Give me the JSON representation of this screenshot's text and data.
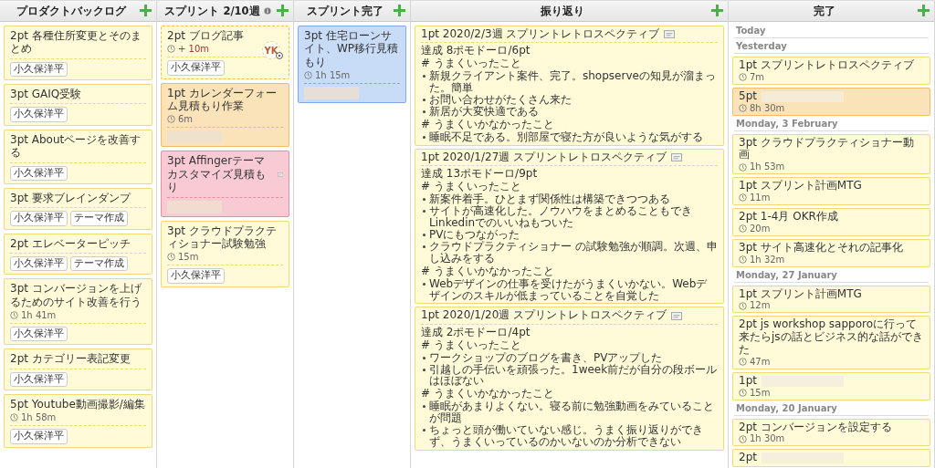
{
  "columns": [
    {
      "title": "プロダクトバックログ",
      "info": false,
      "cards": [
        {
          "title": "2pt 各種住所変更とそのまとめ",
          "color": "#fffbd9",
          "tags": [
            "小久保洋平"
          ]
        },
        {
          "title": "3pt GAIQ受験",
          "color": "#fffbd9",
          "tags": [
            "小久保洋平"
          ]
        },
        {
          "title": "3pt Aboutページを改善する",
          "color": "#fffbd9",
          "tags": [
            "小久保洋平"
          ]
        },
        {
          "title": "3pt 要求ブレインダンプ",
          "color": "#fffbd9",
          "tags": [
            "小久保洋平",
            "テーマ作成"
          ]
        },
        {
          "title": "2pt エレベーターピッチ",
          "color": "#fffbd9",
          "tags": [
            "小久保洋平",
            "テーマ作成"
          ]
        },
        {
          "title": "3pt コンバージョンを上げるためのサイト改善を行う",
          "color": "#fffbd9",
          "timer": {
            "text": "1h 41m",
            "overdue": false
          },
          "tags": [
            "小久保洋平"
          ]
        },
        {
          "title": "2pt カテゴリー表記変更",
          "color": "#fffbd9",
          "tags": [
            "小久保洋平"
          ]
        },
        {
          "title": "5pt Youtube動画撮影/編集",
          "color": "#fffbd9",
          "timer": {
            "text": "1h 58m",
            "overdue": false
          },
          "tags": [
            "小久保洋平"
          ]
        }
      ]
    },
    {
      "title": "スプリント 2/10週",
      "info": true,
      "cards": [
        {
          "title": "2pt ブログ記事",
          "color": "#fffbd9",
          "running": true,
          "assignee": "YK",
          "timer": {
            "text": "+ 10m",
            "overdue": true
          },
          "tags": [
            "小久保洋平"
          ]
        },
        {
          "title": "1pt カレンダーフォーム見積もり作業",
          "color": "#fbe3b9",
          "timer": {
            "text": "6m",
            "overdue": false
          },
          "redacted": true
        },
        {
          "title": "3pt Affingerテーマカスタマイズ見積もり",
          "color": "#f7cad4",
          "note": true,
          "redacted": true
        },
        {
          "title": "3pt クラウドプラクティショナー試験勉強",
          "color": "#fffbd9",
          "timer": {
            "text": "15m",
            "overdue": false
          },
          "tags": [
            "小久保洋平"
          ]
        }
      ]
    },
    {
      "title": "スプリント完了",
      "info": false,
      "cards": [
        {
          "title": "3pt 住宅ローンサイト、WP移行見積もり",
          "color": "#c8dcf7",
          "timer": {
            "text": "1h 15m",
            "overdue": false
          },
          "redacted": true
        }
      ]
    },
    {
      "title": "振り返り",
      "info": false,
      "cards": [
        {
          "title": "1pt 2020/2/3週 スプリントレトロスペクティブ",
          "color": "#fffbd9",
          "note": true,
          "body": [
            {
              "kind": "text",
              "text": "達成 8ポモドーロ/6pt"
            },
            {
              "kind": "text",
              "text": "# うまくいったこと"
            },
            {
              "kind": "list",
              "items": [
                "新規クライアント案件、完了。shopserveの知見が溜まった。簡単",
                "お問い合わせがたくさん来た",
                "新居が大変快適である"
              ]
            },
            {
              "kind": "text",
              "text": "# うまくいかなかったこと"
            },
            {
              "kind": "list",
              "items": [
                "睡眠不足である。別部屋で寝た方が良いような気がする"
              ]
            }
          ]
        },
        {
          "title": "1pt 2020/1/27週 スプリントレトロスペクティブ",
          "color": "#fffbd9",
          "note": true,
          "body": [
            {
              "kind": "text",
              "text": "達成 13ポモドーロ/9pt"
            },
            {
              "kind": "text",
              "text": "# うまくいったこと"
            },
            {
              "kind": "list",
              "items": [
                "新案件着手。ひとまず関係性は構築できつつある",
                "サイトが高速化した。ノウハウをまとめることもでき Linkedinでのいいねもついた",
                "PVにもつながった",
                "クラウドプラクティショナー の試験勉強が順調。次週、申し込みをする"
              ]
            },
            {
              "kind": "text",
              "text": "# うまくいかなかったこと"
            },
            {
              "kind": "list",
              "items": [
                "Webデザインの仕事を受けたがうまくいかない。Webデザインのスキルが低まっていることを自覚した"
              ]
            }
          ]
        },
        {
          "title": "1pt 2020/1/20週 スプリントレトロスペクティブ",
          "color": "#fffbd9",
          "note": true,
          "body": [
            {
              "kind": "text",
              "text": "達成 2ポモドーロ/4pt"
            },
            {
              "kind": "text",
              "text": "# うまくいったこと"
            },
            {
              "kind": "list",
              "items": [
                "ワークショップのブログを書き、PVアップした",
                "引越しの手伝いを頑張った。1week前だが自分の段ボールはほぼない"
              ]
            },
            {
              "kind": "text",
              "text": "# うまくいかなかったこと"
            },
            {
              "kind": "list",
              "items": [
                "睡眠があまりよくない。寝る前に勉強動画をみていることが問題",
                "ちょっと頭が働いていない感じ。うまく振り返りができず、うまくいっているのかいないのか分析できない"
              ]
            }
          ]
        }
      ]
    },
    {
      "title": "完了",
      "info": false,
      "sections": [
        {
          "heading": "Today"
        },
        {
          "heading": "Yesterday",
          "cards": [
            {
              "title": "1pt スプリントレトロスペクティブ",
              "color": "#fffbd9",
              "timer": {
                "text": "7m",
                "overdue": false
              }
            },
            {
              "title": "5pt",
              "color": "#fbe3b9",
              "redacted": true,
              "timer": {
                "text": "8h 30m",
                "overdue": false
              }
            }
          ]
        },
        {
          "heading": "Monday, 3 February",
          "cards": [
            {
              "title": "3pt クラウドプラクティショナー動画",
              "color": "#fffbd9",
              "timer": {
                "text": "1h 53m",
                "overdue": false
              }
            },
            {
              "title": "1pt スプリント計画MTG",
              "color": "#fffbd9",
              "timer": {
                "text": "11m",
                "overdue": false
              }
            },
            {
              "title": "2pt 1-4月 OKR作成",
              "color": "#fffbd9",
              "timer": {
                "text": "20m",
                "overdue": false
              }
            },
            {
              "title": "3pt サイト高速化とそれの記事化",
              "color": "#fffbd9",
              "timer": {
                "text": "1h 32m",
                "overdue": false
              }
            }
          ]
        },
        {
          "heading": "Monday, 27 January",
          "cards": [
            {
              "title": "1pt スプリント計画MTG",
              "color": "#fffbd9",
              "timer": {
                "text": "12m",
                "overdue": false
              }
            },
            {
              "title": "2pt js workshop sapporoに行って来たらjsの話とビジネス的な話ができた",
              "color": "#fffbd9",
              "timer": {
                "text": "47m",
                "overdue": false
              }
            },
            {
              "title": "1pt",
              "color": "#fffbd9",
              "redacted": true,
              "timer": {
                "text": "15m",
                "overdue": false
              }
            }
          ]
        },
        {
          "heading": "Monday, 20 January",
          "cards": [
            {
              "title": "2pt コンバージョンを設定する",
              "color": "#fffbd9",
              "timer": {
                "text": "1h 30m",
                "overdue": false
              }
            },
            {
              "title": "2pt",
              "color": "#fffbd9",
              "redacted": true
            }
          ]
        }
      ]
    }
  ]
}
